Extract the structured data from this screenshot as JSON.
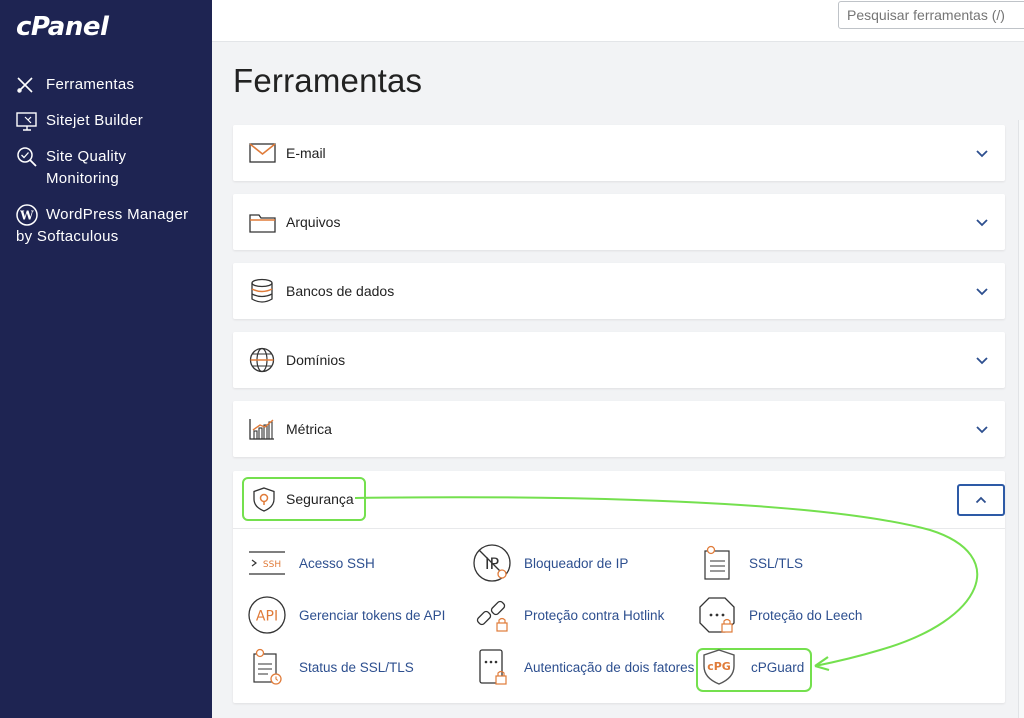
{
  "app": {
    "logo": "cPanel"
  },
  "sidebar": {
    "items": [
      {
        "label": "Ferramentas",
        "icon": "tools-icon"
      },
      {
        "label": "Sitejet Builder",
        "icon": "monitor-icon"
      },
      {
        "label": "Site Quality Monitoring",
        "icon": "magnifier-icon"
      },
      {
        "label": "WordPress Manager by Softaculous",
        "icon": "wordpress-icon"
      }
    ]
  },
  "header": {
    "search_placeholder": "Pesquisar ferramentas (/)"
  },
  "main": {
    "title": "Ferramentas",
    "sections": [
      {
        "label": "E-mail",
        "icon": "envelope-icon",
        "expanded": false
      },
      {
        "label": "Arquivos",
        "icon": "folder-icon",
        "expanded": false
      },
      {
        "label": "Bancos de dados",
        "icon": "database-icon",
        "expanded": false
      },
      {
        "label": "Domínios",
        "icon": "globe-icon",
        "expanded": false
      },
      {
        "label": "Métrica",
        "icon": "bar-chart-icon",
        "expanded": false
      },
      {
        "label": "Segurança",
        "icon": "shield-icon",
        "expanded": true
      }
    ],
    "security_tools": [
      {
        "label": "Acesso SSH",
        "icon": "ssh-icon"
      },
      {
        "label": "Bloqueador de IP",
        "icon": "ip-blocker-icon"
      },
      {
        "label": "SSL/TLS",
        "icon": "certificate-icon"
      },
      {
        "label": "Gerenciar tokens de API",
        "icon": "api-icon"
      },
      {
        "label": "Proteção contra Hotlink",
        "icon": "broken-link-icon"
      },
      {
        "label": "Proteção do Leech",
        "icon": "leech-icon"
      },
      {
        "label": "Status de SSL/TLS",
        "icon": "certificate-status-icon"
      },
      {
        "label": "Autenticação de dois fatores",
        "icon": "two-factor-icon"
      },
      {
        "label": "cPGuard",
        "icon": "cpguard-icon"
      }
    ]
  },
  "icon_text": {
    "ssh": "SSH",
    "api": "API",
    "ip": "IP",
    "cpg": "cPG"
  },
  "colors": {
    "sidebar": "#1e2452",
    "link": "#2d4f8f",
    "highlight": "#74e04e",
    "accent_orange": "#e07b39"
  }
}
